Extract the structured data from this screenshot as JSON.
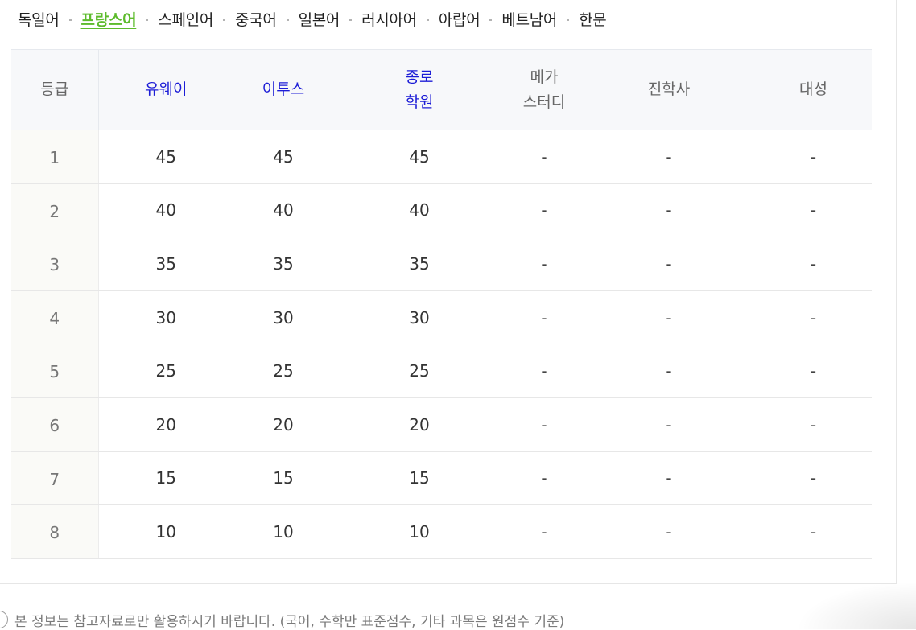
{
  "languages": {
    "tabs": [
      "독일어",
      "프랑스어",
      "스페인어",
      "중국어",
      "일본어",
      "러시아어",
      "아랍어",
      "베트남어",
      "한문"
    ],
    "active": "프랑스어"
  },
  "table": {
    "headers": [
      {
        "text": "등급",
        "color": "#666666"
      },
      {
        "text": "유웨이",
        "color": "#1c1cd6"
      },
      {
        "text": "이투스",
        "color": "#1c1cd6"
      },
      {
        "text": "종로\n학원",
        "color": "#1c1cd6"
      },
      {
        "text": "메가\n스터디",
        "color": "#666666"
      },
      {
        "text": "진학사",
        "color": "#666666"
      },
      {
        "text": "대성",
        "color": "#666666"
      }
    ],
    "rows": [
      [
        "1",
        "45",
        "45",
        "45",
        "-",
        "-",
        "-"
      ],
      [
        "2",
        "40",
        "40",
        "40",
        "-",
        "-",
        "-"
      ],
      [
        "3",
        "35",
        "35",
        "35",
        "-",
        "-",
        "-"
      ],
      [
        "4",
        "30",
        "30",
        "30",
        "-",
        "-",
        "-"
      ],
      [
        "5",
        "25",
        "25",
        "25",
        "-",
        "-",
        "-"
      ],
      [
        "6",
        "20",
        "20",
        "20",
        "-",
        "-",
        "-"
      ],
      [
        "7",
        "15",
        "15",
        "15",
        "-",
        "-",
        "-"
      ],
      [
        "8",
        "10",
        "10",
        "10",
        "-",
        "-",
        "-"
      ]
    ]
  },
  "footnote": {
    "text": "본 정보는 참고자료로만 활용하시기 바랍니다. (국어, 수학만 표준점수, 기타 과목은 원점수 기준)",
    "icon": "info-icon"
  },
  "colors": {
    "accent": "#5dbb2c",
    "link_blue": "#1c1cd6"
  }
}
